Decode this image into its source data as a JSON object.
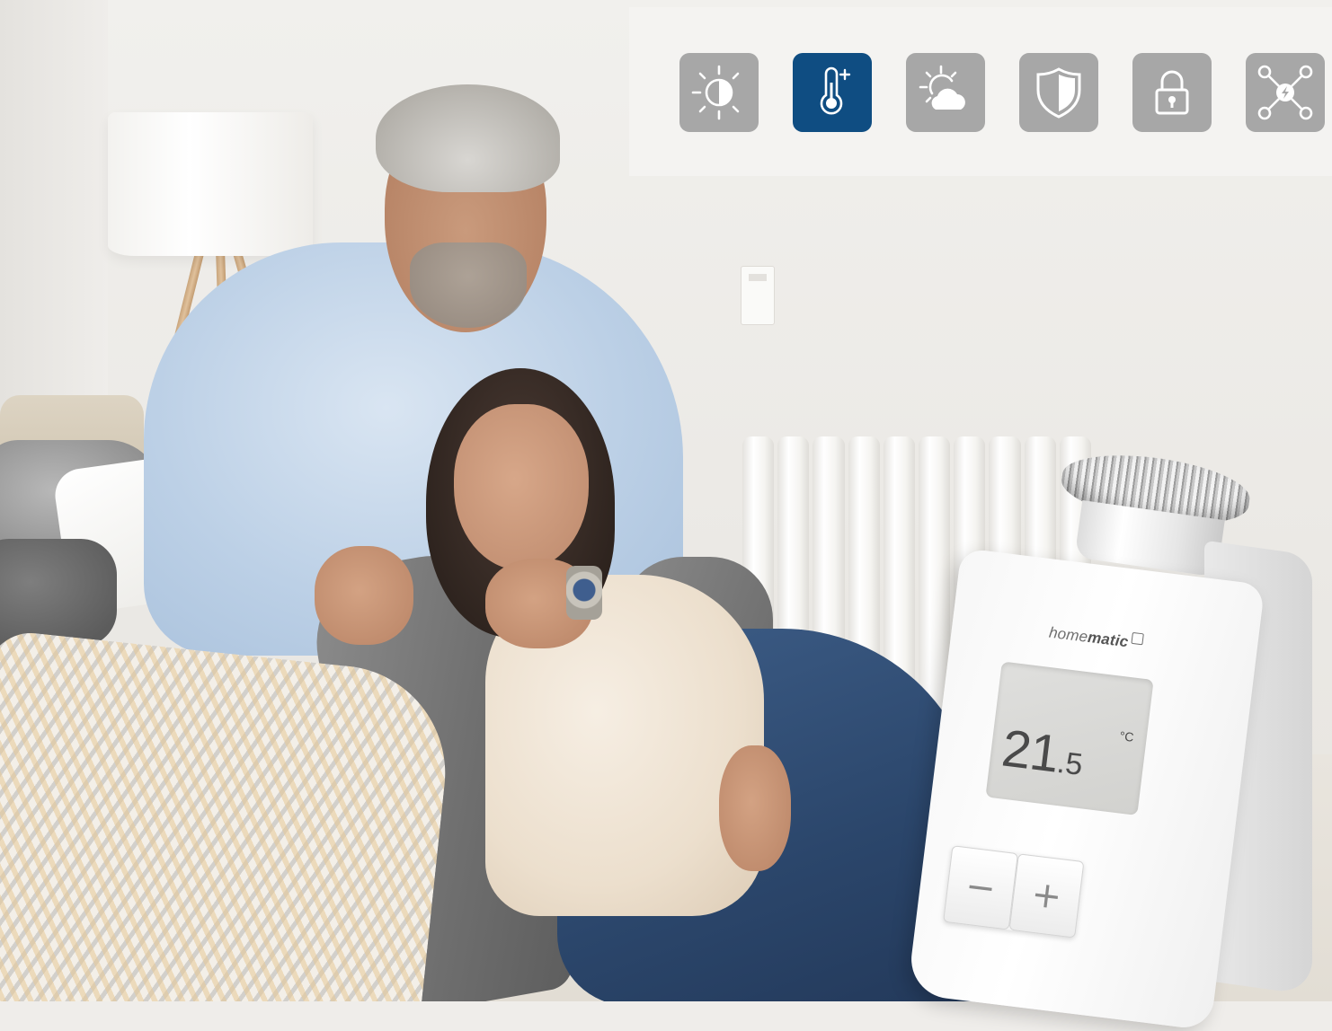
{
  "icon_bar": {
    "active_color": "#0f4d82",
    "inactive_color": "#a7a7a7",
    "icons": [
      {
        "name": "light-icon",
        "active": false
      },
      {
        "name": "heating-icon",
        "active": true
      },
      {
        "name": "weather-icon",
        "active": false
      },
      {
        "name": "security-icon",
        "active": false
      },
      {
        "name": "access-icon",
        "active": false
      },
      {
        "name": "network-icon",
        "active": false
      }
    ]
  },
  "device": {
    "brand_prefix": "home",
    "brand_bold": "matic",
    "temperature_integer": "21",
    "temperature_decimal": ".5",
    "temperature_unit": "°C",
    "minus_label": "−",
    "plus_label": "+"
  }
}
